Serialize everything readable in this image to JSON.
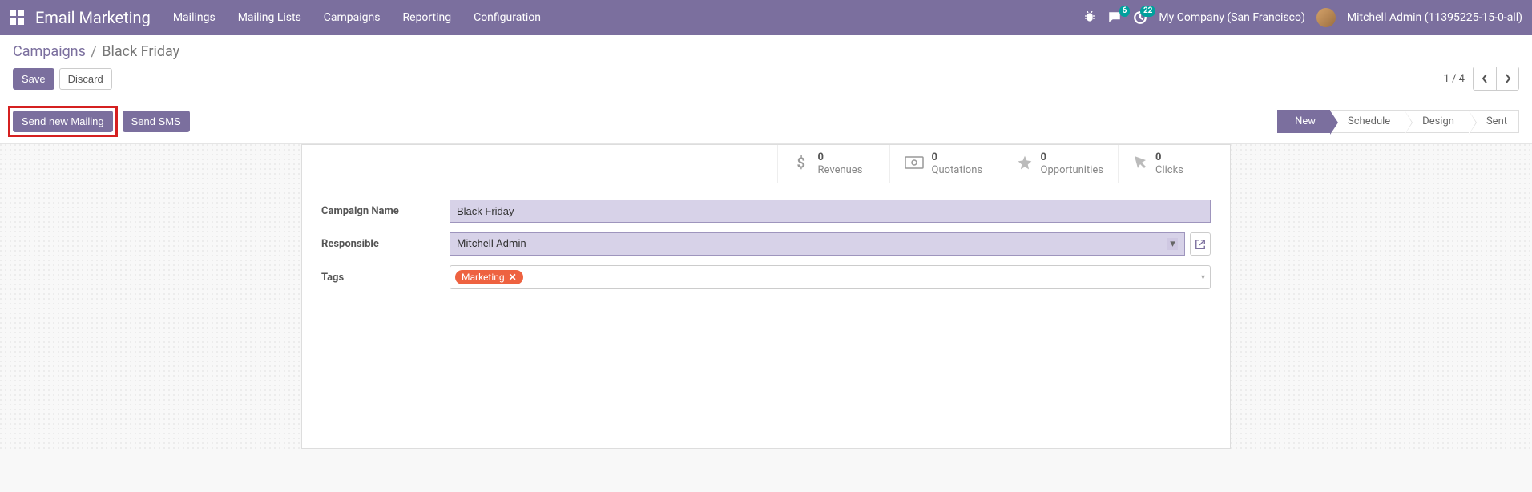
{
  "header": {
    "appTitle": "Email Marketing",
    "menu": [
      "Mailings",
      "Mailing Lists",
      "Campaigns",
      "Reporting",
      "Configuration"
    ],
    "chatBadge": "6",
    "activityBadge": "22",
    "company": "My Company (San Francisco)",
    "user": "Mitchell Admin (11395225-15-0-all)"
  },
  "breadcrumb": {
    "parent": "Campaigns",
    "current": "Black Friday"
  },
  "buttons": {
    "save": "Save",
    "discard": "Discard",
    "sendMailing": "Send new Mailing",
    "sendSms": "Send SMS"
  },
  "pager": {
    "text": "1 / 4"
  },
  "stages": [
    "New",
    "Schedule",
    "Design",
    "Sent"
  ],
  "stats": [
    {
      "count": "0",
      "label": "Revenues",
      "icon": "dollar"
    },
    {
      "count": "0",
      "label": "Quotations",
      "icon": "money"
    },
    {
      "count": "0",
      "label": "Opportunities",
      "icon": "star"
    },
    {
      "count": "0",
      "label": "Clicks",
      "icon": "cursor"
    }
  ],
  "form": {
    "campaignLabel": "Campaign Name",
    "campaignValue": "Black Friday",
    "responsibleLabel": "Responsible",
    "responsibleValue": "Mitchell Admin",
    "tagsLabel": "Tags",
    "tags": [
      "Marketing"
    ]
  }
}
